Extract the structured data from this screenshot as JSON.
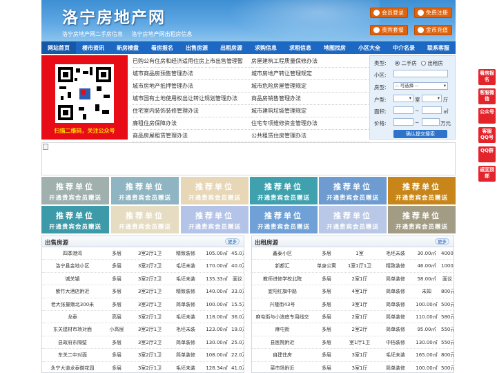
{
  "header": {
    "title": "洛宁房地产网",
    "subtitles": [
      "洛宁房地产网二手房信息",
      "洛宁房地产网出租房信息"
    ],
    "buttons": [
      {
        "label": "会员登录",
        "icon": "user-icon"
      },
      {
        "label": "免费注册",
        "icon": "register-icon"
      },
      {
        "label": "贵宾套餐",
        "icon": "vip-icon"
      },
      {
        "label": "金币充值",
        "icon": "coin-icon"
      }
    ]
  },
  "nav": [
    "网站首页",
    "楼市资讯",
    "新房楼盘",
    "看房报名",
    "出售房源",
    "出租房源",
    "求购信息",
    "求租信息",
    "地图找房",
    "小区大全",
    "中介名录",
    "联系客服"
  ],
  "qr": {
    "caption": "扫描二维码，关注公众号"
  },
  "news_left": [
    "已购公有住房和经济适用住房上市出售管理暂",
    "城市商品房预售管理办法",
    "城市房地产抵押管理办法",
    "城市国有土地使用权出让转让规划管理办法",
    "住宅室内装饰装修管理办法",
    "廉租住房保障办法",
    "商品房屋租赁管理办法"
  ],
  "news_right": [
    "房屋建筑工程质量保修办法",
    "城市房地产转让管理规定",
    "城市危险房屋管理规定",
    "商品房销售管理办法",
    "城市建筑垃圾管理规定",
    "住宅专项维修资金管理办法",
    "公共租赁住房管理办法"
  ],
  "search": {
    "type_label": "类型:",
    "type_options": [
      "二手房",
      "出租房"
    ],
    "area_label": "小区:",
    "style_label": "房型:",
    "style_value": "-- 可选择 --",
    "room_label": "户型:",
    "room_unit": "室",
    "hall_unit": "厅",
    "size_label": "面积:",
    "size_unit": "㎡",
    "price_label": "价格:",
    "price_unit": "万元",
    "range_sep": "~",
    "submit": "确认提交搜索"
  },
  "recommend": {
    "title": "推荐单位",
    "subtitle": "开通贵宾会员赠送"
  },
  "recommend_colors": [
    "#9fb0ae",
    "#8fb5c2",
    "#e8d7b7",
    "#3ea1ad",
    "#6e9cd0",
    "#c8861a",
    "#3d9aa8",
    "#e6dcc2",
    "#b4c4e8",
    "#6fa0d6",
    "#b8c8e6",
    "#a39c84"
  ],
  "sale": {
    "title": "出售房源",
    "more": "更多",
    "rows": [
      [
        "四季港湾",
        "多层",
        "3室2厅1卫",
        "精致装修",
        "105.00㎡",
        "45.0万"
      ],
      [
        "洛宁县金地小区",
        "多层",
        "3室2厅2卫",
        "毛坯未装",
        "170.00㎡",
        "40.0万"
      ],
      [
        "城关镇",
        "多层",
        "3室2厅2卫",
        "毛坯未装",
        "135.33㎡",
        "面议"
      ],
      [
        "紫竹大酒店附近",
        "多层",
        "3室2厅1卫",
        "精致装修",
        "140.00㎡",
        "33.0万"
      ],
      [
        "老大张量贩北300米",
        "多层",
        "3室2厅1卫",
        "简单装修",
        "100.00㎡",
        "15.5万"
      ],
      [
        "龙泰",
        "高层",
        "3室2厅1卫",
        "毛坯未装",
        "118.00㎡",
        "36.0万"
      ],
      [
        "东关建材市场对面",
        "小高层",
        "3室2厅1卫",
        "毛坯未装",
        "123.00㎡",
        "19.0万"
      ],
      [
        "县政府东隔壁",
        "多层",
        "3室2厅2卫",
        "简单装修",
        "130.00㎡",
        "25.0万"
      ],
      [
        "东关二中对面",
        "多层",
        "3室2厅1卫",
        "简单装修",
        "108.00㎡",
        "22.0万"
      ],
      [
        "永宁大道龙泰御花园",
        "多层",
        "3室2厅1卫",
        "毛坯未装",
        "128.34㎡",
        "41.0万"
      ]
    ]
  },
  "rent": {
    "title": "出租房源",
    "more": "更多",
    "rows": [
      [
        "鑫泰小区",
        "多层",
        "1室",
        "毛坯未装",
        "30.00㎡",
        "4000元"
      ],
      [
        "新都汇",
        "单身公寓",
        "1室1厅1卫",
        "精致装修",
        "46.00㎡",
        "1000元"
      ],
      [
        "教师进修学校北院",
        "多层",
        "2室1厅",
        "简单装修",
        "58.00㎡",
        "面议"
      ],
      [
        "宜阳红旗中路",
        "多层",
        "4室1厅",
        "简单装修",
        "未知",
        "800元"
      ],
      [
        "兴隆街43号",
        "多层",
        "3室1厅",
        "简单装修",
        "100.00㎡",
        "500元"
      ],
      [
        "麻屯街与小浪底专用线交",
        "多层",
        "2室1厅",
        "简单装修",
        "110.00㎡",
        "580元"
      ],
      [
        "麻屯街",
        "多层",
        "2室2厅",
        "简单装修",
        "95.00㎡",
        "550元"
      ],
      [
        "县医院附近",
        "多层",
        "室1厅1卫",
        "中档装修",
        "130.00㎡",
        "550元"
      ],
      [
        "自建住房",
        "多层",
        "3室1厅",
        "毛坯未装",
        "165.00㎡",
        "800元"
      ],
      [
        "菜市场附近",
        "多层",
        "3室1厅",
        "简单装修",
        "100.00㎡",
        "500元"
      ]
    ]
  },
  "side": [
    "看房报名",
    "客服微信",
    "公众号",
    "客服QQ号",
    "QQ群",
    "返回顶部"
  ]
}
